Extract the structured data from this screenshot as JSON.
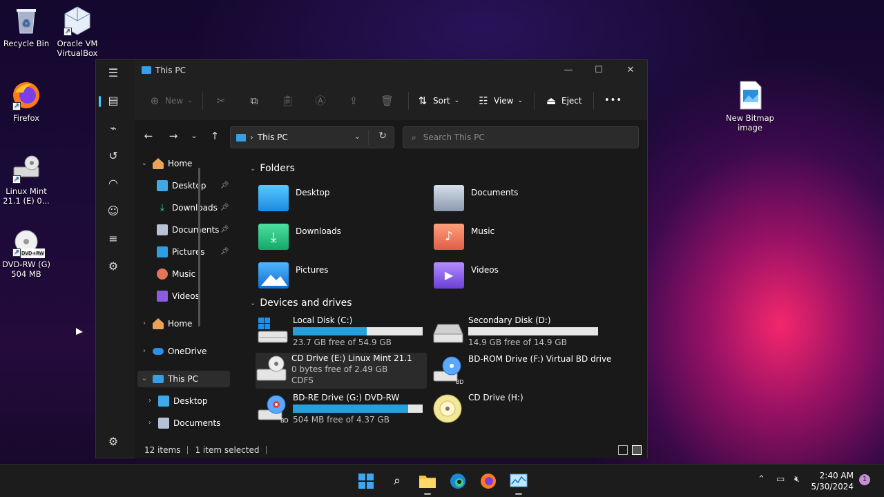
{
  "desktop": {
    "icons": [
      {
        "label": "Recycle Bin"
      },
      {
        "label": "Oracle VM VirtualBox"
      },
      {
        "label": "Firefox"
      },
      {
        "label": "Linux Mint 21.1 (E) 0..."
      },
      {
        "label": "DVD-RW (G) 504 MB",
        "badge": "DVD+RW"
      },
      {
        "label": "New Bitmap image"
      }
    ]
  },
  "window": {
    "title": "This PC",
    "toolbar": {
      "new_label": "New",
      "sort_label": "Sort",
      "view_label": "View",
      "eject_label": "Eject",
      "more_label": "•••"
    },
    "address": {
      "location": "This PC"
    },
    "search": {
      "placeholder": "Search This PC"
    },
    "nav": {
      "items": [
        {
          "label": "Home"
        },
        {
          "label": "Desktop"
        },
        {
          "label": "Downloads"
        },
        {
          "label": "Documents"
        },
        {
          "label": "Pictures"
        },
        {
          "label": "Music"
        },
        {
          "label": "Videos"
        },
        {
          "label": "Home"
        },
        {
          "label": "OneDrive"
        },
        {
          "label": "This PC"
        },
        {
          "label": "Desktop"
        },
        {
          "label": "Documents"
        }
      ]
    },
    "folders_header": "Folders",
    "folders": [
      {
        "label": "Desktop"
      },
      {
        "label": "Documents"
      },
      {
        "label": "Downloads"
      },
      {
        "label": "Music"
      },
      {
        "label": "Pictures"
      },
      {
        "label": "Videos"
      }
    ],
    "drives_header": "Devices and drives",
    "drives": [
      {
        "name": "Local Disk (C:)",
        "free": "23.7 GB free of 54.9 GB",
        "used_fraction": 0.57
      },
      {
        "name": "Secondary Disk (D:)",
        "free": "14.9 GB free of 14.9 GB",
        "used_fraction": 0.0
      },
      {
        "name": "CD Drive (E:) Linux Mint 21.1",
        "free": "0 bytes free of 2.49 GB",
        "fs": "CDFS"
      },
      {
        "name": "BD-ROM Drive (F:) Virtual BD drive"
      },
      {
        "name": "BD-RE Drive (G:) DVD-RW",
        "free": "504 MB free of 4.37 GB",
        "used_fraction": 0.89,
        "badge": "BD"
      },
      {
        "name": "CD Drive (H:)"
      }
    ],
    "status": {
      "items": "12 items",
      "selected": "1 item selected"
    }
  },
  "taskbar": {
    "clock_time": "2:40 AM",
    "clock_date": "5/30/2024",
    "notification_count": "1"
  },
  "colors": {
    "accent": "#26a0da",
    "window_bg": "#191919",
    "toolbar_bg": "#202020"
  }
}
